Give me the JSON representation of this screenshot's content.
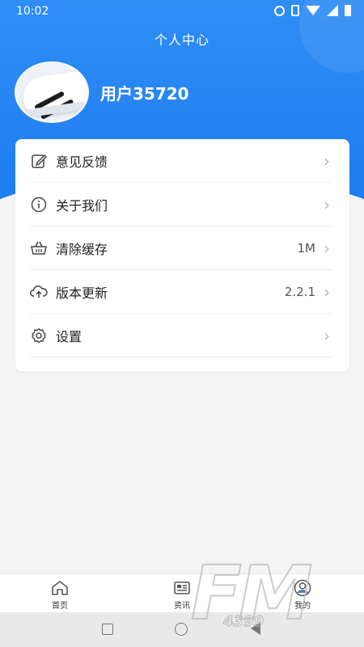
{
  "status_bar": {
    "time": "10:02",
    "icons": [
      "alarm-icon",
      "vibrate-icon",
      "wifi-icon",
      "signal-icon",
      "battery-icon"
    ]
  },
  "header": {
    "title": "个人中心",
    "username": "用户35720",
    "gradient_color": "#2f8df6"
  },
  "menu": {
    "items": [
      {
        "icon": "edit-icon",
        "label": "意见反馈",
        "value": ""
      },
      {
        "icon": "info-icon",
        "label": "关于我们",
        "value": ""
      },
      {
        "icon": "basket-icon",
        "label": "清除缓存",
        "value": "1M"
      },
      {
        "icon": "cloud-upload-icon",
        "label": "版本更新",
        "value": "2.2.1"
      },
      {
        "icon": "gear-icon",
        "label": "设置",
        "value": ""
      }
    ]
  },
  "bottom_nav": {
    "items": [
      {
        "icon": "home-icon",
        "label": "首页"
      },
      {
        "icon": "news-icon",
        "label": "资讯"
      },
      {
        "icon": "profile-icon",
        "label": "我的"
      }
    ]
  },
  "watermark": {
    "main": "FM",
    "sub": "4399"
  }
}
